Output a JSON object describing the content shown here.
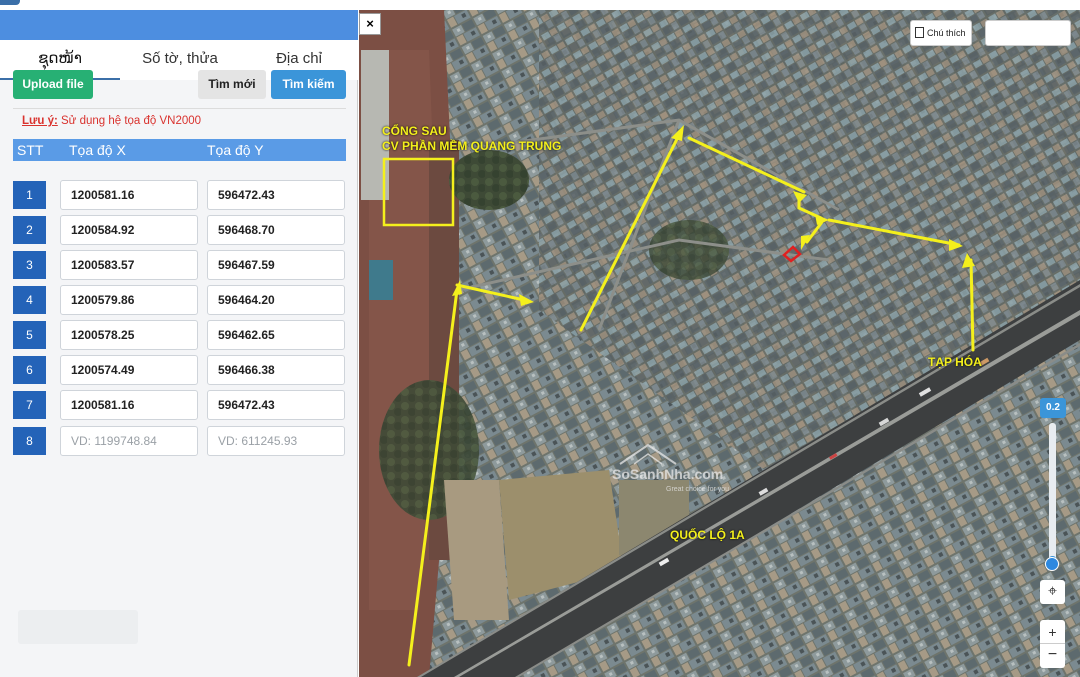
{
  "panel": {
    "tabs": [
      {
        "label": "ຊຸດໜ້າ"
      },
      {
        "label": "Số tờ, thửa"
      },
      {
        "label": "Địa chỉ"
      }
    ],
    "buttons": {
      "upload": "Upload file",
      "new": "Tìm mới",
      "search": "Tìm kiếm"
    },
    "note": {
      "label": "Lưu ý:",
      "text": " Sử dụng hệ tọa độ VN2000"
    },
    "table": {
      "headers": {
        "stt": "STT",
        "x": "Tọa độ X",
        "y": "Tọa độ Y"
      },
      "rows": [
        {
          "stt": "1",
          "x": "1200581.16",
          "y": "596472.43"
        },
        {
          "stt": "2",
          "x": "1200584.92",
          "y": "596468.70"
        },
        {
          "stt": "3",
          "x": "1200583.57",
          "y": "596467.59"
        },
        {
          "stt": "4",
          "x": "1200579.86",
          "y": "596464.20"
        },
        {
          "stt": "5",
          "x": "1200578.25",
          "y": "596462.65"
        },
        {
          "stt": "6",
          "x": "1200574.49",
          "y": "596466.38"
        },
        {
          "stt": "7",
          "x": "1200581.16",
          "y": "596472.43"
        },
        {
          "stt": "8",
          "x_placeholder": "VD: 1199748.84",
          "y_placeholder": "VD: 611245.93"
        }
      ]
    }
  },
  "map": {
    "close": "×",
    "legend_button": "Chú thích",
    "labels": {
      "cong_sau_line1": "CỔNG SAU",
      "cong_sau_line2": "CV PHẦN MỀM QUANG TRUNG",
      "tap_hoa": "TẠP HÓA",
      "quoc_lo": "QUỐC LỘ 1A"
    },
    "watermark": {
      "main": "SoSanhNha.com",
      "sub": "Great choice for you"
    },
    "zoom": {
      "value": "0.2",
      "level": 0.06,
      "zoom_in": "+",
      "zoom_out": "−",
      "locate": "⌖"
    },
    "colors": {
      "annotation": "#f4f01c",
      "parcel": "#e02020"
    }
  }
}
